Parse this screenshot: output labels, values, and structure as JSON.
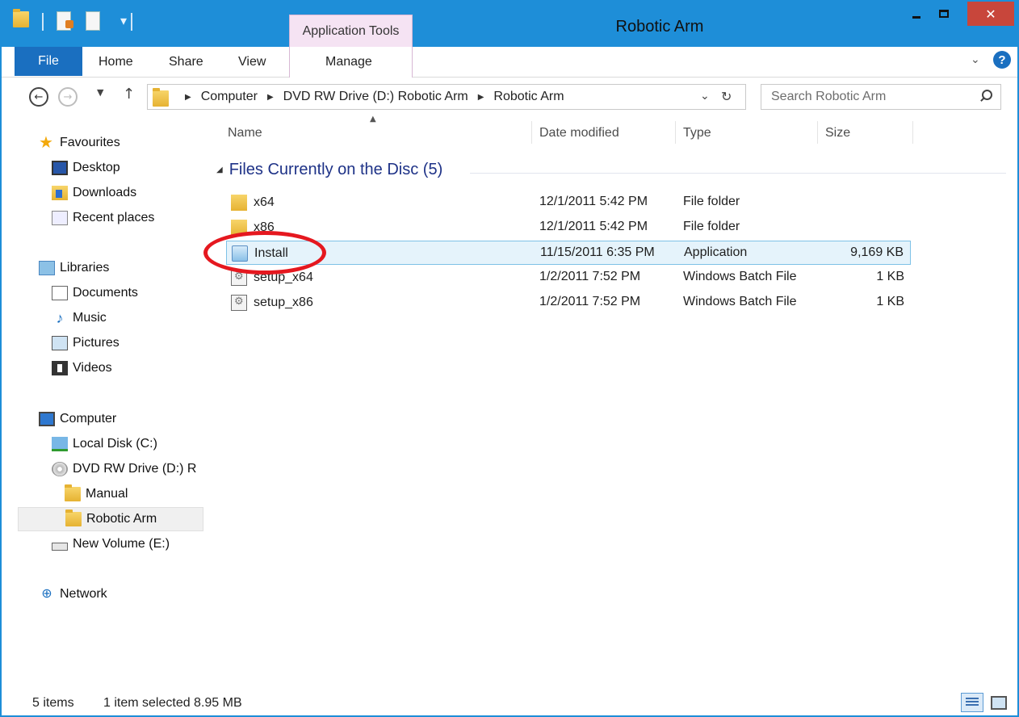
{
  "window": {
    "title": "Robotic Arm",
    "contextual_tab": "Application Tools",
    "close_glyph": "✕"
  },
  "ribbon": {
    "tabs": [
      "File",
      "Home",
      "Share",
      "View",
      "Manage"
    ]
  },
  "address": {
    "crumbs": [
      "Computer",
      "DVD RW Drive (D:) Robotic Arm",
      "Robotic Arm"
    ],
    "search_placeholder": "Search Robotic Arm"
  },
  "nav_pane": {
    "items": [
      {
        "label": "Favourites",
        "icon": "star-icon"
      },
      {
        "label": "Desktop",
        "icon": "desktop-icon"
      },
      {
        "label": "Downloads",
        "icon": "downloads-icon"
      },
      {
        "label": "Recent places",
        "icon": "recent-places-icon"
      },
      {
        "label": "Libraries",
        "icon": "libraries-icon"
      },
      {
        "label": "Documents",
        "icon": "documents-icon"
      },
      {
        "label": "Music",
        "icon": "music-icon"
      },
      {
        "label": "Pictures",
        "icon": "pictures-icon"
      },
      {
        "label": "Videos",
        "icon": "videos-icon"
      },
      {
        "label": "Computer",
        "icon": "computer-icon"
      },
      {
        "label": "Local Disk (C:)",
        "icon": "local-disk-icon"
      },
      {
        "label": "DVD RW Drive (D:) R",
        "icon": "dvd-drive-icon"
      },
      {
        "label": "Manual",
        "icon": "folder-icon"
      },
      {
        "label": "Robotic Arm",
        "icon": "folder-icon",
        "selected": true
      },
      {
        "label": "New Volume (E:)",
        "icon": "volume-icon"
      },
      {
        "label": "Network",
        "icon": "network-icon"
      }
    ]
  },
  "columns": [
    "Name",
    "Date modified",
    "Type",
    "Size"
  ],
  "group": {
    "label": "Files Currently on the Disc (5)"
  },
  "files": [
    {
      "name": "x64",
      "date": "12/1/2011 5:42 PM",
      "type": "File folder",
      "size": "",
      "icon": "folder-icon"
    },
    {
      "name": "x86",
      "date": "12/1/2011 5:42 PM",
      "type": "File folder",
      "size": "",
      "icon": "folder-icon"
    },
    {
      "name": "Install",
      "date": "11/15/2011 6:35 PM",
      "type": "Application",
      "size": "9,169 KB",
      "icon": "application-icon",
      "selected": true
    },
    {
      "name": "setup_x64",
      "date": "1/2/2011 7:52 PM",
      "type": "Windows Batch File",
      "size": "1 KB",
      "icon": "batch-file-icon"
    },
    {
      "name": "setup_x86",
      "date": "1/2/2011 7:52 PM",
      "type": "Windows Batch File",
      "size": "1 KB",
      "icon": "batch-file-icon"
    }
  ],
  "status": {
    "item_count": "5 items",
    "selection": "1 item selected  8.95 MB"
  },
  "colors": {
    "title_bar": "#1e8ed8",
    "file_tab": "#1a6fc0",
    "contextual_tab": "#f5e3f3",
    "selection": "#e5f3fb",
    "highlight_ring": "#e5181f",
    "group_text": "#1e3287"
  }
}
